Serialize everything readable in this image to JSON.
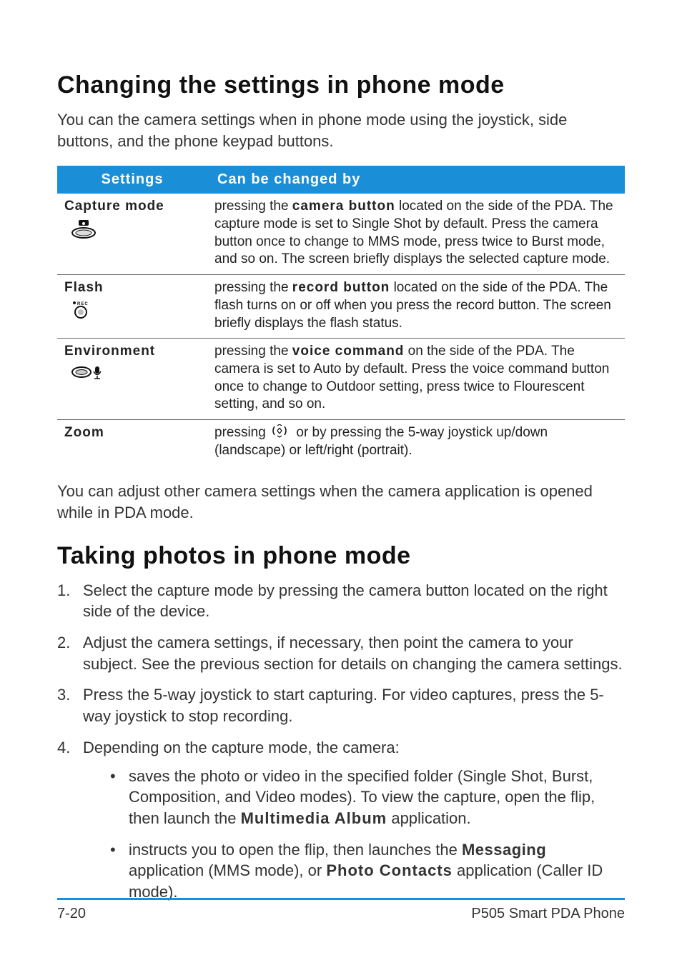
{
  "headings": {
    "changing_settings": "Changing the settings in phone mode",
    "taking_photos": "Taking photos in phone mode"
  },
  "paragraphs": {
    "intro1": "You can the camera settings when in phone mode using the joystick, side buttons, and the phone keypad buttons.",
    "intro2": "You can adjust other camera settings when the camera application is opened while in PDA mode."
  },
  "table": {
    "header_settings": "Settings",
    "header_changed_by": "Can be changed by",
    "rows": [
      {
        "name": "Capture mode",
        "desc_pre": "pressing the ",
        "desc_bold": "camera button",
        "desc_post": " located on the side of the PDA. The capture mode is set to Single Shot by default. Press the camera button once to change to MMS mode, press twice to Burst mode, and so on. The screen briefly displays the selected capture mode."
      },
      {
        "name": "Flash",
        "desc_pre": "pressing the ",
        "desc_bold": "record button",
        "desc_post": " located on the side of the PDA. The flash turns on or off when you press the record button. The screen briefly displays the flash status."
      },
      {
        "name": "Environment",
        "desc_pre": "pressing the ",
        "desc_bold": "voice command",
        "desc_post": " on the side of the PDA. The camera is set to Auto by default. Press the voice command button once to change to Outdoor setting, press twice to Flourescent setting, and so on."
      },
      {
        "name": "Zoom",
        "desc_pre": "pressing ",
        "desc_bold": "",
        "desc_post": " or by pressing the 5-way joystick up/down (landscape) or left/right (portrait)."
      }
    ]
  },
  "steps": {
    "s1": "Select the capture mode by pressing the camera button located on the right side of the device.",
    "s2": "Adjust the camera settings, if necessary, then point the camera to your subject. See the previous section for details on changing the camera settings.",
    "s3": "Press the 5-way joystick to start capturing. For video captures, press the 5-way joystick to stop recording.",
    "s4": "Depending on the capture mode, the camera:",
    "b1_pre": "saves the photo or video in the specified folder (Single Shot, Burst, Composition, and Video modes). To view the capture, open the flip, then launch the ",
    "b1_bold": "Multimedia Album",
    "b1_post": " application.",
    "b2_pre": "instructs you to open the flip, then launches the ",
    "b2_bold1": "Messaging",
    "b2_mid": " application (MMS mode), or ",
    "b2_bold2": "Photo Contacts",
    "b2_post": " application (Caller ID mode)."
  },
  "footer": {
    "left": "7-20",
    "right": "P505 Smart PDA Phone"
  }
}
